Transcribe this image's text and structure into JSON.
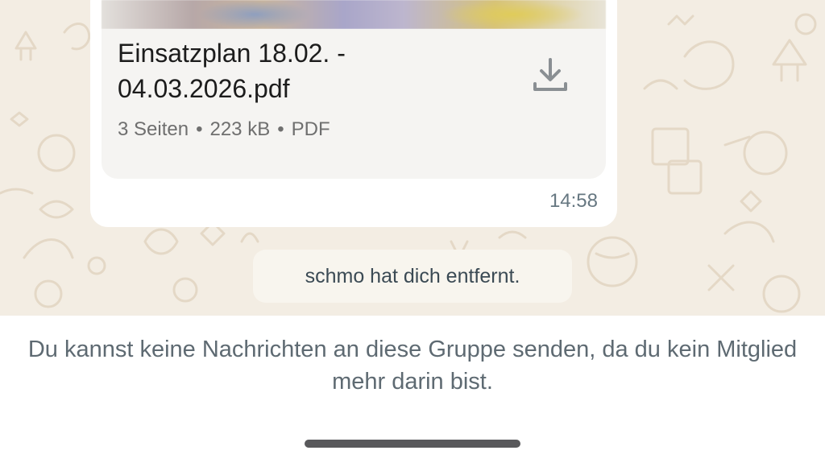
{
  "message": {
    "document": {
      "title": "Einsatzplan 18.02. -\n04.03.2026.pdf",
      "pages": "3 Seiten",
      "size": "223 kB",
      "type": "PDF",
      "separator": "•",
      "download_icon": "download-icon"
    },
    "time": "14:58"
  },
  "system_message": "schmo hat dich entfernt.",
  "footer": {
    "notice": "Du kannst keine Nachrichten an diese Gruppe senden, da du kein Mitglied mehr darin bist."
  },
  "colors": {
    "chat_background": "#f3ede3",
    "bubble": "#ffffff",
    "doc_card": "#f5f4f2",
    "icon": "#8a8f93"
  }
}
